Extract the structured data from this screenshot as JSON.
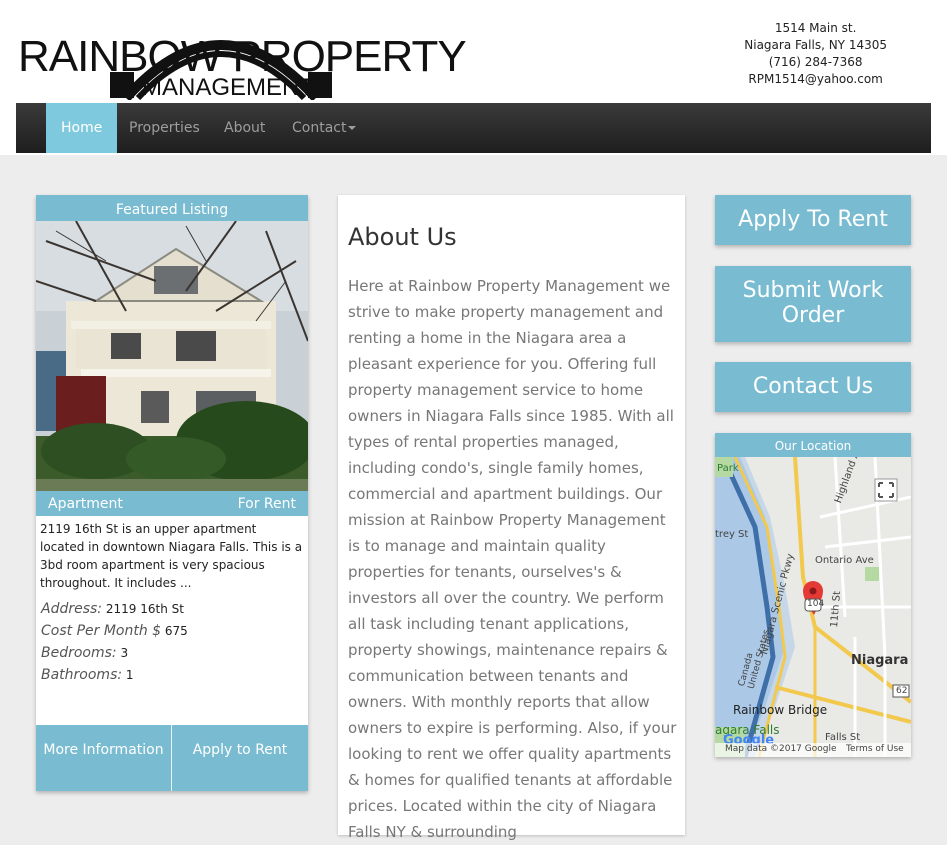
{
  "header": {
    "logo_line1": "RAINBOW PROPERTY",
    "logo_line2": "MANAGEMENT",
    "address": "1514 Main st.",
    "city": "Niagara Falls, NY 14305",
    "phone": "(716) 284-7368",
    "email": "RPM1514@yahoo.com"
  },
  "nav": {
    "items": [
      {
        "label": "Home",
        "active": true
      },
      {
        "label": "Properties",
        "active": false
      },
      {
        "label": "About",
        "active": false
      },
      {
        "label": "Contact",
        "active": false
      }
    ]
  },
  "featured": {
    "heading": "Featured Listing",
    "type": "Apartment",
    "status": "For Rent",
    "description": "2119 16th St is an upper apartment located in downtown Niagara Falls. This is a 3bd room apartment is very spacious throughout. It includes ...",
    "address_label": "Address:",
    "address_value": "2119 16th St",
    "cost_label": "Cost Per Month $",
    "cost_value": "675",
    "bedrooms_label": "Bedrooms:",
    "bedrooms_value": "3",
    "bathrooms_label": "Bathrooms:",
    "bathrooms_value": "1",
    "more_info_label": "More Information",
    "apply_label": "Apply to Rent"
  },
  "about": {
    "title": "About Us",
    "body": "Here at Rainbow Property Management we strive to make property management and renting a home in the Niagara area a pleasant experience for you. Offering full property management service to home owners in Niagara Falls since 1985. With all types of rental properties managed, including condo's, single family homes, commercial and apartment buildings. Our mission at Rainbow Property Management is to manage and maintain quality properties for tenants, ourselves's & investors all over the country. We perform all task including tenant applications, property showings, maintenance repairs & communication between tenants and owners. With monthly reports that allow owners to expire is performing. Also, if your looking to rent we offer quality apartments & homes for qualified tenants at affordable prices. Located within the city of Niagara Falls NY & surrounding"
  },
  "sidebar": {
    "apply_label": "Apply To Rent",
    "work_order_label": "Submit Work Order",
    "contact_label": "Contact Us",
    "location_heading": "Our Location"
  },
  "map": {
    "labels": {
      "park": "Park",
      "highland": "Highland Ave",
      "trey": "trey St",
      "ontario": "Ontario Ave",
      "pkwy": "Niagara Scenic Pkwy",
      "rte104": "104",
      "eleventh": "11th St",
      "niagara": "Niagara",
      "rte62": "62",
      "canada_states": "Canada\nUnited States",
      "bridge": "Rainbow Bridge",
      "falls_a": "agara Falls",
      "falls_st": "Falls St",
      "attribution": "Map data ©2017 Google",
      "terms": "Terms of Use",
      "google": "Google"
    }
  }
}
